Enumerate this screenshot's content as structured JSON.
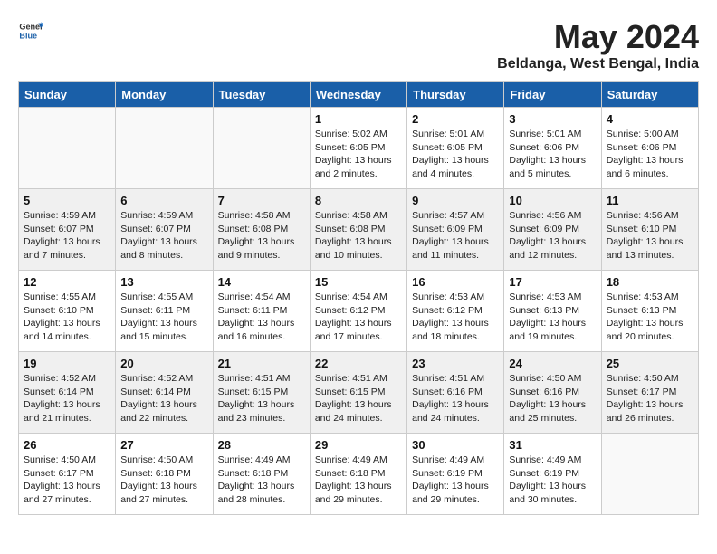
{
  "header": {
    "logo_general": "General",
    "logo_blue": "Blue",
    "month_year": "May 2024",
    "location": "Beldanga, West Bengal, India"
  },
  "days_of_week": [
    "Sunday",
    "Monday",
    "Tuesday",
    "Wednesday",
    "Thursday",
    "Friday",
    "Saturday"
  ],
  "weeks": [
    [
      {
        "day": "",
        "info": ""
      },
      {
        "day": "",
        "info": ""
      },
      {
        "day": "",
        "info": ""
      },
      {
        "day": "1",
        "info": "Sunrise: 5:02 AM\nSunset: 6:05 PM\nDaylight: 13 hours\nand 2 minutes."
      },
      {
        "day": "2",
        "info": "Sunrise: 5:01 AM\nSunset: 6:05 PM\nDaylight: 13 hours\nand 4 minutes."
      },
      {
        "day": "3",
        "info": "Sunrise: 5:01 AM\nSunset: 6:06 PM\nDaylight: 13 hours\nand 5 minutes."
      },
      {
        "day": "4",
        "info": "Sunrise: 5:00 AM\nSunset: 6:06 PM\nDaylight: 13 hours\nand 6 minutes."
      }
    ],
    [
      {
        "day": "5",
        "info": "Sunrise: 4:59 AM\nSunset: 6:07 PM\nDaylight: 13 hours\nand 7 minutes."
      },
      {
        "day": "6",
        "info": "Sunrise: 4:59 AM\nSunset: 6:07 PM\nDaylight: 13 hours\nand 8 minutes."
      },
      {
        "day": "7",
        "info": "Sunrise: 4:58 AM\nSunset: 6:08 PM\nDaylight: 13 hours\nand 9 minutes."
      },
      {
        "day": "8",
        "info": "Sunrise: 4:58 AM\nSunset: 6:08 PM\nDaylight: 13 hours\nand 10 minutes."
      },
      {
        "day": "9",
        "info": "Sunrise: 4:57 AM\nSunset: 6:09 PM\nDaylight: 13 hours\nand 11 minutes."
      },
      {
        "day": "10",
        "info": "Sunrise: 4:56 AM\nSunset: 6:09 PM\nDaylight: 13 hours\nand 12 minutes."
      },
      {
        "day": "11",
        "info": "Sunrise: 4:56 AM\nSunset: 6:10 PM\nDaylight: 13 hours\nand 13 minutes."
      }
    ],
    [
      {
        "day": "12",
        "info": "Sunrise: 4:55 AM\nSunset: 6:10 PM\nDaylight: 13 hours\nand 14 minutes."
      },
      {
        "day": "13",
        "info": "Sunrise: 4:55 AM\nSunset: 6:11 PM\nDaylight: 13 hours\nand 15 minutes."
      },
      {
        "day": "14",
        "info": "Sunrise: 4:54 AM\nSunset: 6:11 PM\nDaylight: 13 hours\nand 16 minutes."
      },
      {
        "day": "15",
        "info": "Sunrise: 4:54 AM\nSunset: 6:12 PM\nDaylight: 13 hours\nand 17 minutes."
      },
      {
        "day": "16",
        "info": "Sunrise: 4:53 AM\nSunset: 6:12 PM\nDaylight: 13 hours\nand 18 minutes."
      },
      {
        "day": "17",
        "info": "Sunrise: 4:53 AM\nSunset: 6:13 PM\nDaylight: 13 hours\nand 19 minutes."
      },
      {
        "day": "18",
        "info": "Sunrise: 4:53 AM\nSunset: 6:13 PM\nDaylight: 13 hours\nand 20 minutes."
      }
    ],
    [
      {
        "day": "19",
        "info": "Sunrise: 4:52 AM\nSunset: 6:14 PM\nDaylight: 13 hours\nand 21 minutes."
      },
      {
        "day": "20",
        "info": "Sunrise: 4:52 AM\nSunset: 6:14 PM\nDaylight: 13 hours\nand 22 minutes."
      },
      {
        "day": "21",
        "info": "Sunrise: 4:51 AM\nSunset: 6:15 PM\nDaylight: 13 hours\nand 23 minutes."
      },
      {
        "day": "22",
        "info": "Sunrise: 4:51 AM\nSunset: 6:15 PM\nDaylight: 13 hours\nand 24 minutes."
      },
      {
        "day": "23",
        "info": "Sunrise: 4:51 AM\nSunset: 6:16 PM\nDaylight: 13 hours\nand 24 minutes."
      },
      {
        "day": "24",
        "info": "Sunrise: 4:50 AM\nSunset: 6:16 PM\nDaylight: 13 hours\nand 25 minutes."
      },
      {
        "day": "25",
        "info": "Sunrise: 4:50 AM\nSunset: 6:17 PM\nDaylight: 13 hours\nand 26 minutes."
      }
    ],
    [
      {
        "day": "26",
        "info": "Sunrise: 4:50 AM\nSunset: 6:17 PM\nDaylight: 13 hours\nand 27 minutes."
      },
      {
        "day": "27",
        "info": "Sunrise: 4:50 AM\nSunset: 6:18 PM\nDaylight: 13 hours\nand 27 minutes."
      },
      {
        "day": "28",
        "info": "Sunrise: 4:49 AM\nSunset: 6:18 PM\nDaylight: 13 hours\nand 28 minutes."
      },
      {
        "day": "29",
        "info": "Sunrise: 4:49 AM\nSunset: 6:18 PM\nDaylight: 13 hours\nand 29 minutes."
      },
      {
        "day": "30",
        "info": "Sunrise: 4:49 AM\nSunset: 6:19 PM\nDaylight: 13 hours\nand 29 minutes."
      },
      {
        "day": "31",
        "info": "Sunrise: 4:49 AM\nSunset: 6:19 PM\nDaylight: 13 hours\nand 30 minutes."
      },
      {
        "day": "",
        "info": ""
      }
    ]
  ]
}
